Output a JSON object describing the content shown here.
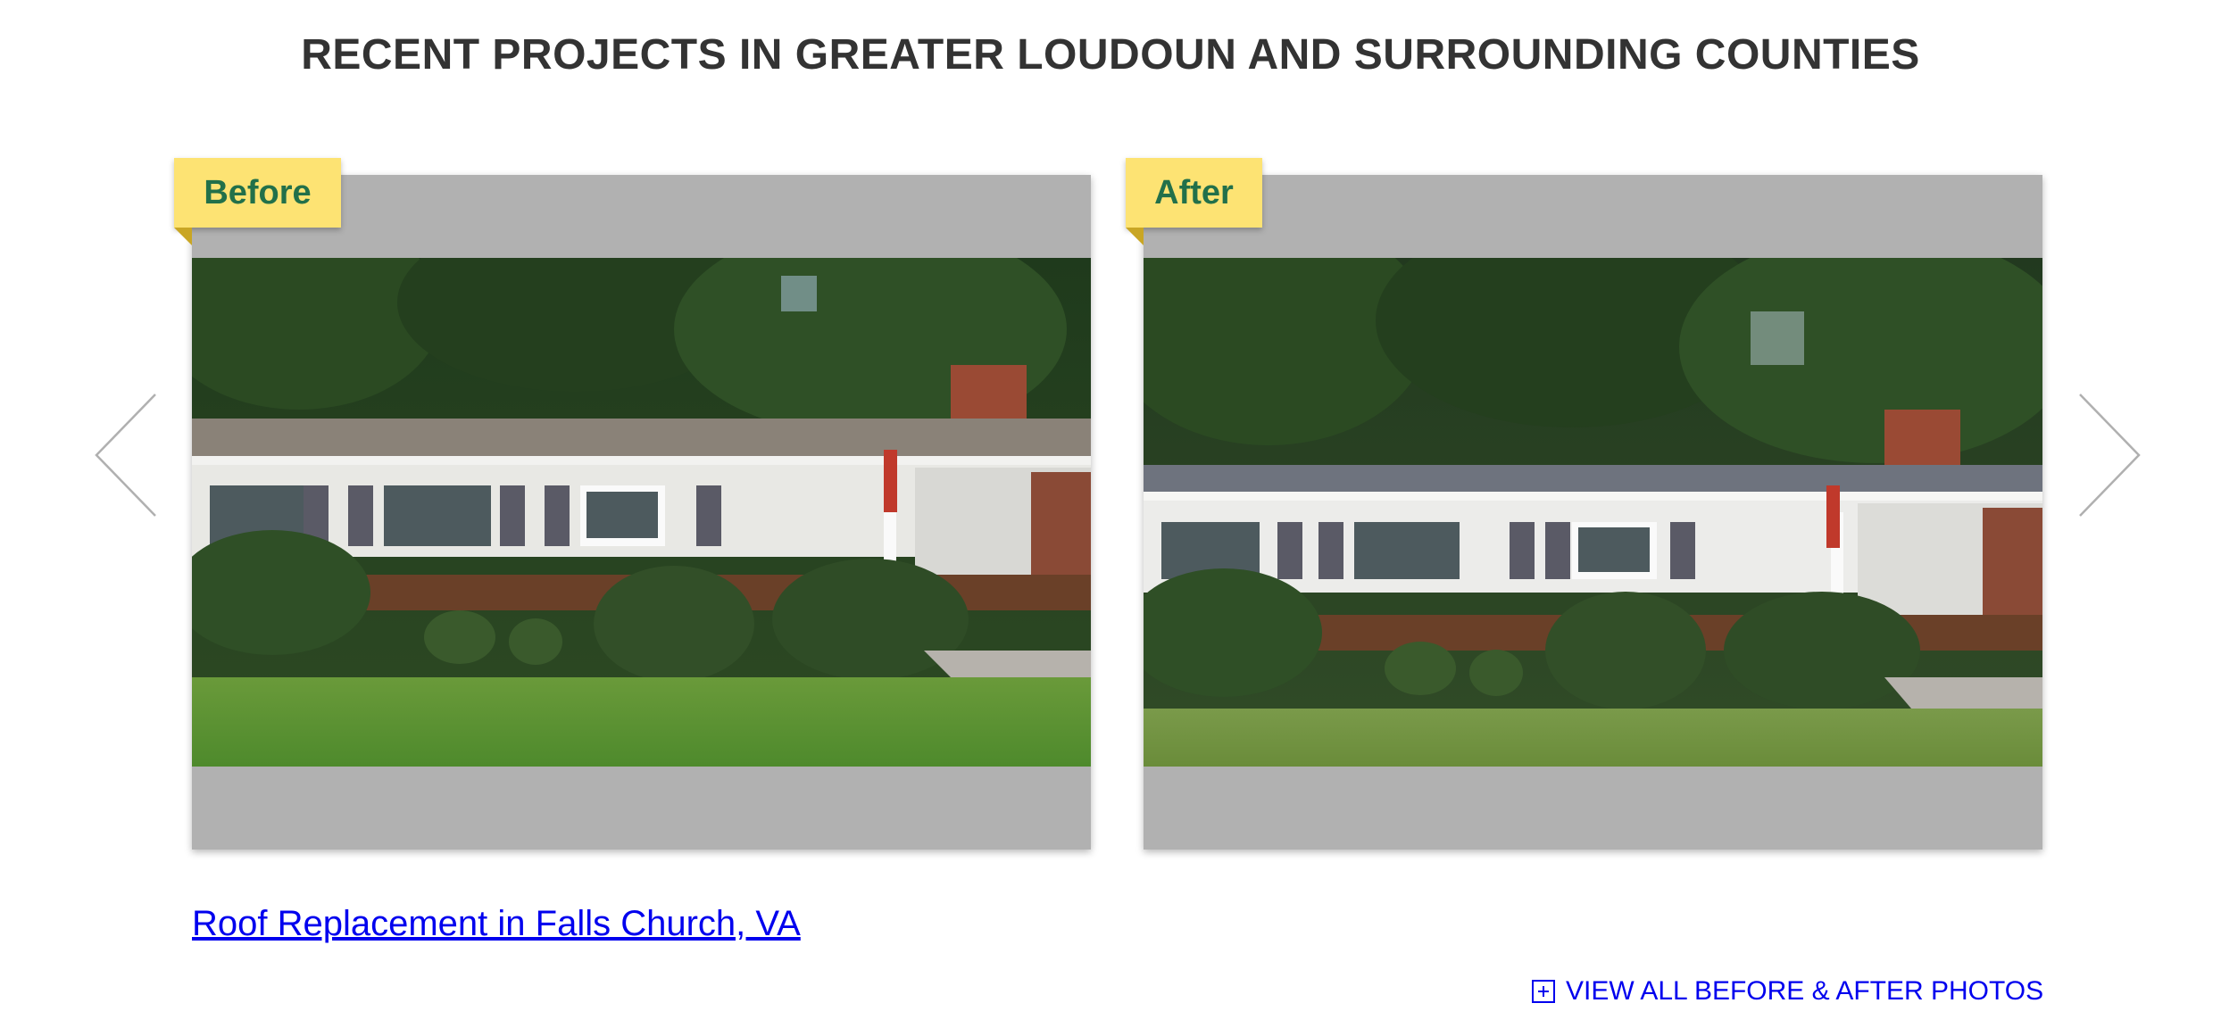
{
  "section": {
    "title": "RECENT PROJECTS IN GREATER LOUDOUN AND SURROUNDING COUNTIES"
  },
  "carousel": {
    "prev_icon": "chevron-left-icon",
    "next_icon": "chevron-right-icon",
    "before": {
      "label": "Before"
    },
    "after": {
      "label": "After"
    }
  },
  "project": {
    "link_text": "Roof Replacement in Falls Church, VA"
  },
  "view_all": {
    "icon": "plus-box-icon",
    "label": "VIEW ALL BEFORE & AFTER PHOTOS"
  },
  "colors": {
    "title": "#333333",
    "tag_background": "#fde373",
    "tag_text": "#22704a",
    "card_background": "#b1b1b1",
    "link": "#0000ee",
    "arrow": "#b0b0b0"
  }
}
